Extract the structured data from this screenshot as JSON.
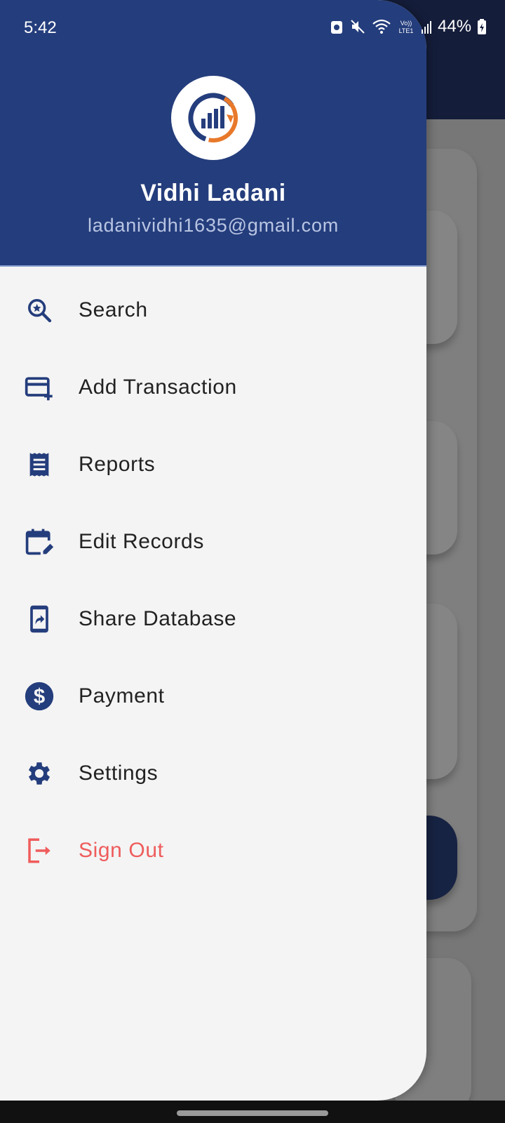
{
  "status_bar": {
    "time": "5:42",
    "battery": "44%"
  },
  "drawer": {
    "user": {
      "name": "Vidhi Ladani",
      "email": "ladanividhi1635@gmail.com"
    },
    "items": [
      {
        "label": "Search",
        "icon": "search-star-icon"
      },
      {
        "label": "Add Transaction",
        "icon": "card-add-icon"
      },
      {
        "label": "Reports",
        "icon": "receipt-icon"
      },
      {
        "label": "Edit Records",
        "icon": "calendar-edit-icon"
      },
      {
        "label": "Share Database",
        "icon": "phone-share-icon"
      },
      {
        "label": "Payment",
        "icon": "dollar-circle-icon"
      },
      {
        "label": "Settings",
        "icon": "gear-icon"
      },
      {
        "label": "Sign Out",
        "icon": "logout-icon"
      }
    ]
  },
  "colors": {
    "primary": "#243d7c",
    "danger": "#ef5c5c",
    "accent": "#e8792a"
  }
}
